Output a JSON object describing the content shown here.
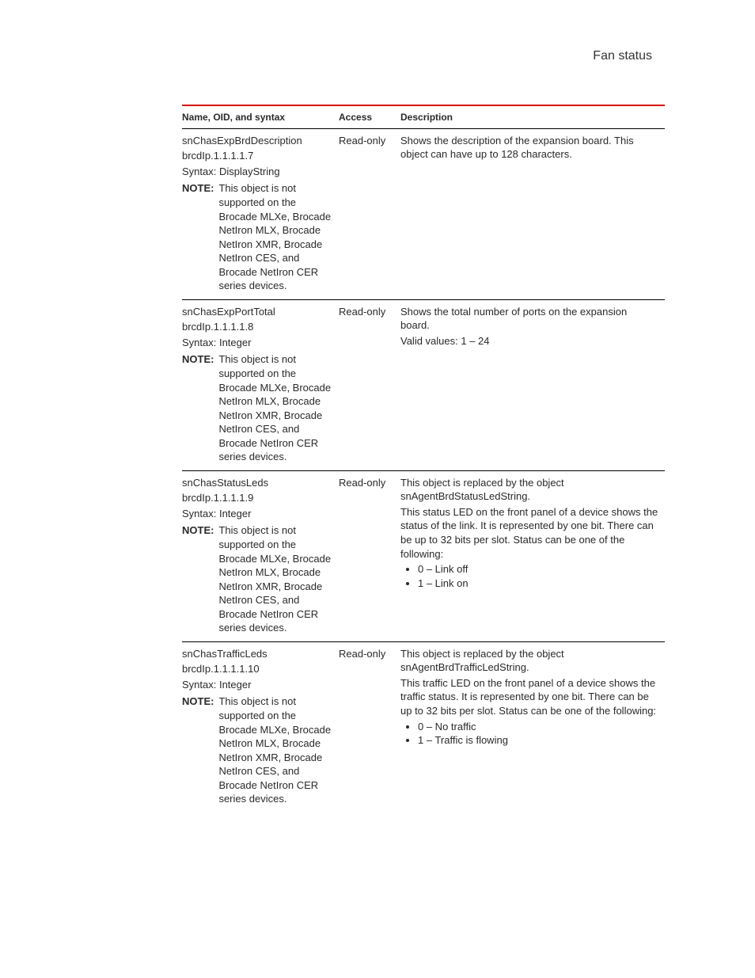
{
  "header": {
    "title": "Fan status"
  },
  "table": {
    "headers": {
      "name": "Name, OID, and syntax",
      "access": "Access",
      "desc": "Description"
    },
    "note_label": "NOTE:",
    "common_note": "This object is not supported on the Brocade MLXe, Brocade NetIron MLX, Brocade NetIron XMR, Brocade NetIron CES, and Brocade NetIron CER series devices.",
    "rows": [
      {
        "name": "snChasExpBrdDescription",
        "oid": "brcdIp.1.1.1.1.7",
        "syntax": "Syntax: DisplayString",
        "access": "Read-only",
        "desc_paras": [
          "Shows the description of the expansion board. This object can have up to 128 characters."
        ],
        "bullets": []
      },
      {
        "name": "snChasExpPortTotal",
        "oid": "brcdIp.1.1.1.1.8",
        "syntax": "Syntax: Integer",
        "access": "Read-only",
        "desc_paras": [
          "Shows the total number of ports on the expansion board.",
          "Valid values: 1 – 24"
        ],
        "bullets": []
      },
      {
        "name": "snChasStatusLeds",
        "oid": "brcdIp.1.1.1.1.9",
        "syntax": "Syntax: Integer",
        "access": "Read-only",
        "desc_paras": [
          "This object is replaced by the object snAgentBrdStatusLedString.",
          "This status LED on the front panel of a device shows the status of the link. It is represented by one bit. There can be up to 32 bits per slot. Status can be one of the following:"
        ],
        "bullets": [
          "0 – Link off",
          "1 – Link on"
        ]
      },
      {
        "name": "snChasTrafficLeds",
        "oid": "brcdIp.1.1.1.1.10",
        "syntax": "Syntax: Integer",
        "access": "Read-only",
        "desc_paras": [
          "This object is replaced by the object snAgentBrdTrafficLedString.",
          "This traffic LED on the front panel of a device shows the traffic status. It is represented by one bit. There can be up to 32 bits per slot. Status can be one of the following:"
        ],
        "bullets": [
          "0 – No traffic",
          "1 – Traffic is flowing"
        ]
      }
    ]
  }
}
